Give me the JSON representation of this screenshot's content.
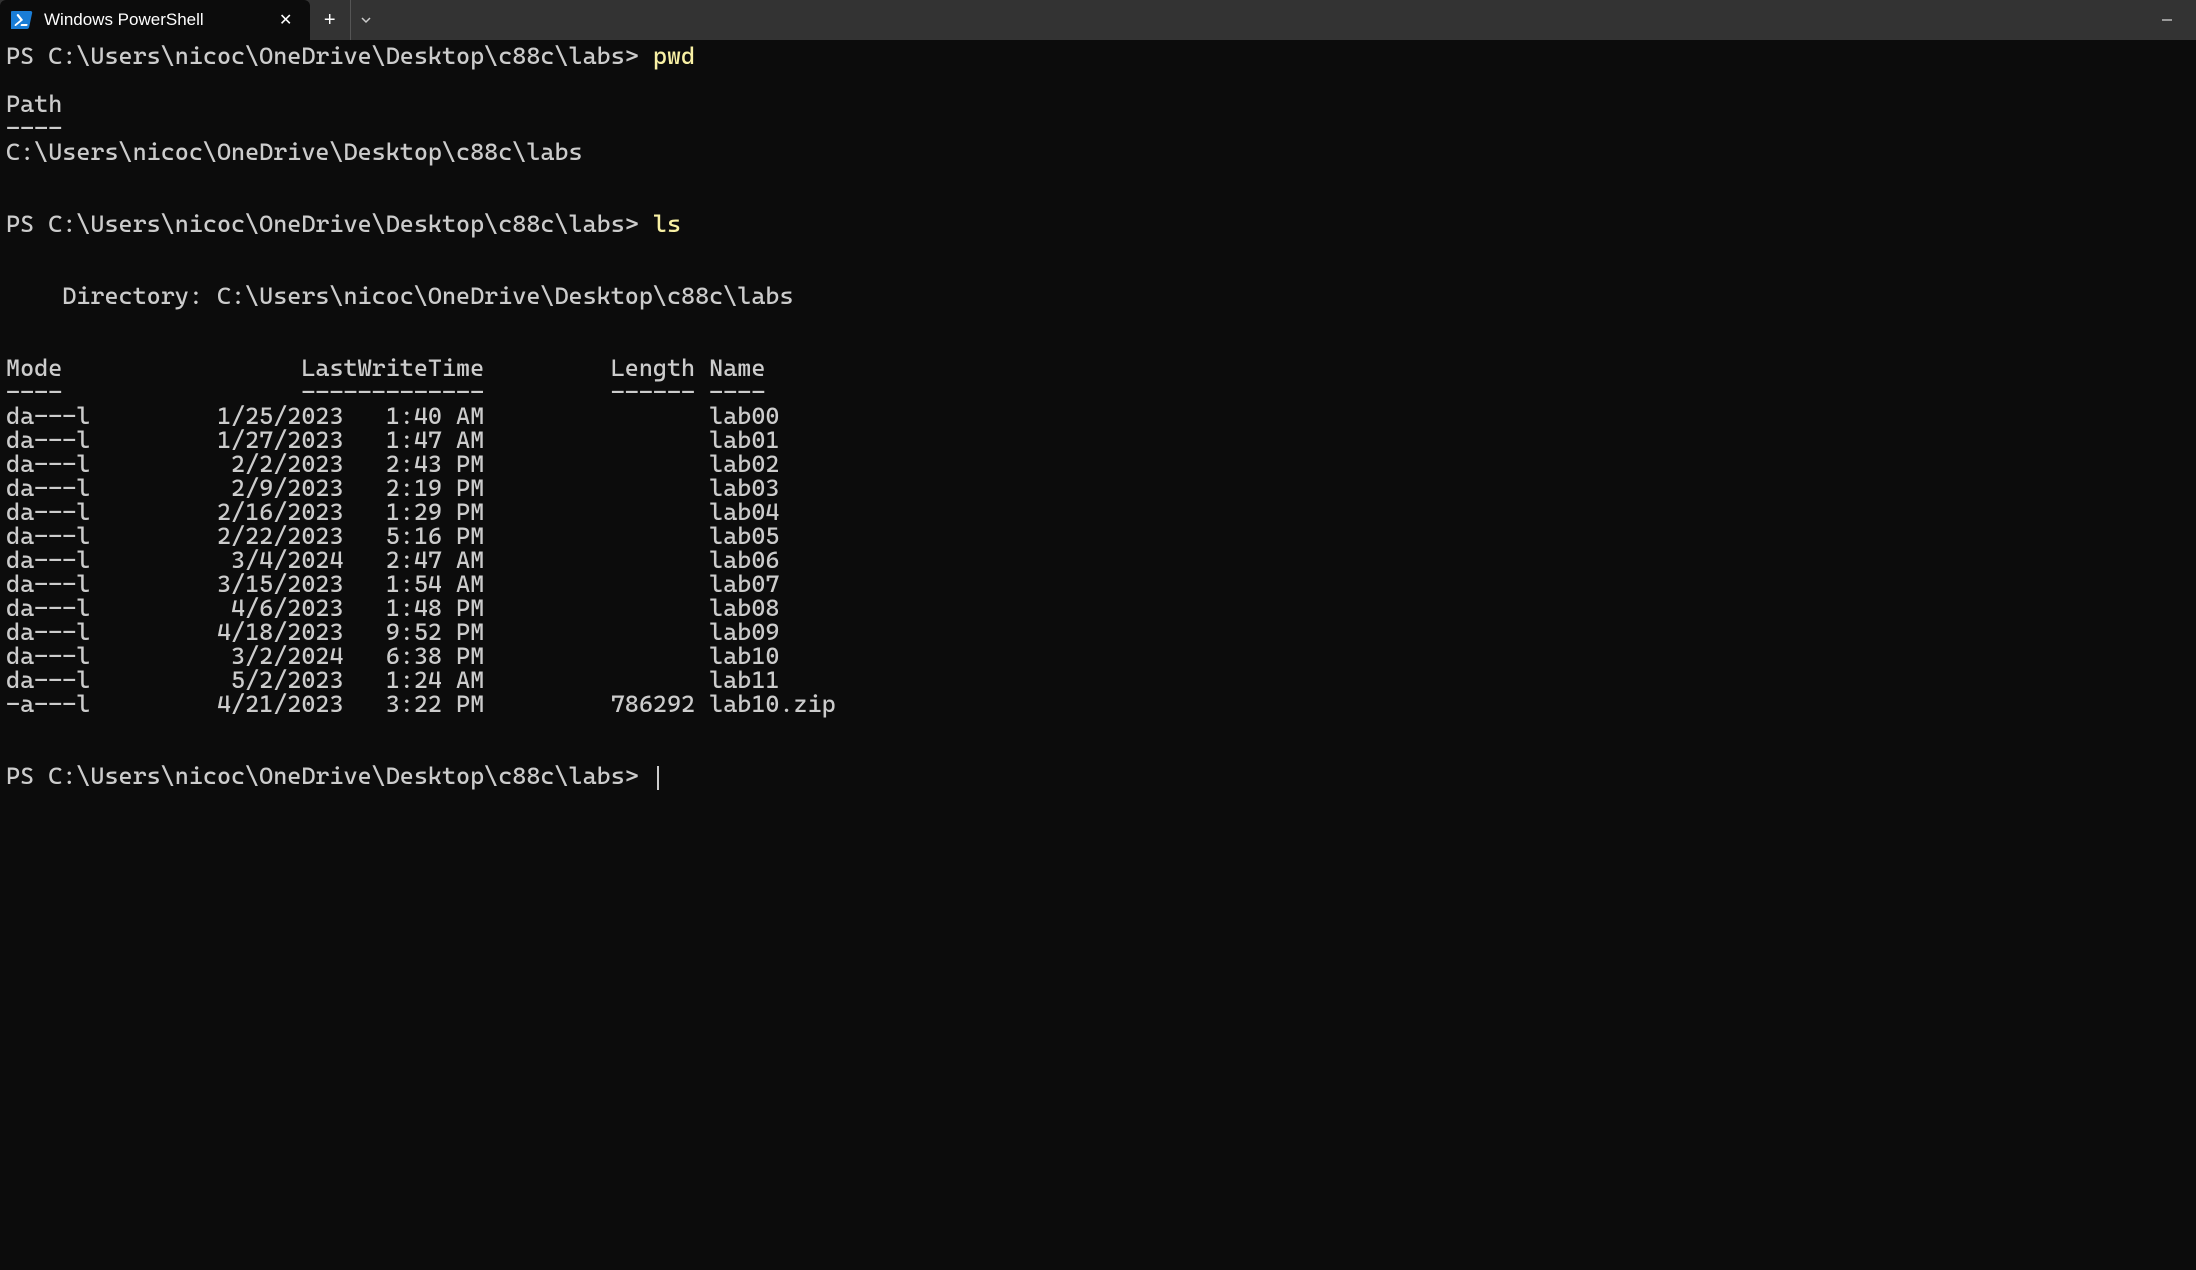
{
  "tab": {
    "title": "Windows PowerShell"
  },
  "prompt_text": "PS C:\\Users\\nicoc\\OneDrive\\Desktop\\c88c\\labs>",
  "commands": {
    "cmd1": "pwd",
    "cmd2": "ls"
  },
  "pwd_output": {
    "header": "Path",
    "divider": "----",
    "value": "C:\\Users\\nicoc\\OneDrive\\Desktop\\c88c\\labs"
  },
  "ls_output": {
    "directory_label": "    Directory: C:\\Users\\nicoc\\OneDrive\\Desktop\\c88c\\labs",
    "headers": {
      "mode": "Mode",
      "lastwrite": "LastWriteTime",
      "length": "Length",
      "name": "Name"
    },
    "dividers": {
      "mode": "----",
      "lastwrite": "-------------",
      "length": "------",
      "name": "----"
    },
    "rows": [
      {
        "mode": "da---l",
        "date": "1/25/2023",
        "time": "1:40 AM",
        "length": "",
        "name": "lab00"
      },
      {
        "mode": "da---l",
        "date": "1/27/2023",
        "time": "1:47 AM",
        "length": "",
        "name": "lab01"
      },
      {
        "mode": "da---l",
        "date": "2/2/2023",
        "time": "2:43 PM",
        "length": "",
        "name": "lab02"
      },
      {
        "mode": "da---l",
        "date": "2/9/2023",
        "time": "2:19 PM",
        "length": "",
        "name": "lab03"
      },
      {
        "mode": "da---l",
        "date": "2/16/2023",
        "time": "1:29 PM",
        "length": "",
        "name": "lab04"
      },
      {
        "mode": "da---l",
        "date": "2/22/2023",
        "time": "5:16 PM",
        "length": "",
        "name": "lab05"
      },
      {
        "mode": "da---l",
        "date": "3/4/2024",
        "time": "2:47 AM",
        "length": "",
        "name": "lab06"
      },
      {
        "mode": "da---l",
        "date": "3/15/2023",
        "time": "1:54 AM",
        "length": "",
        "name": "lab07"
      },
      {
        "mode": "da---l",
        "date": "4/6/2023",
        "time": "1:48 PM",
        "length": "",
        "name": "lab08"
      },
      {
        "mode": "da---l",
        "date": "4/18/2023",
        "time": "9:52 PM",
        "length": "",
        "name": "lab09"
      },
      {
        "mode": "da---l",
        "date": "3/2/2024",
        "time": "6:38 PM",
        "length": "",
        "name": "lab10"
      },
      {
        "mode": "da---l",
        "date": "5/2/2023",
        "time": "1:24 AM",
        "length": "",
        "name": "lab11"
      },
      {
        "mode": "-a---l",
        "date": "4/21/2023",
        "time": "3:22 PM",
        "length": "786292",
        "name": "lab10.zip"
      }
    ]
  }
}
